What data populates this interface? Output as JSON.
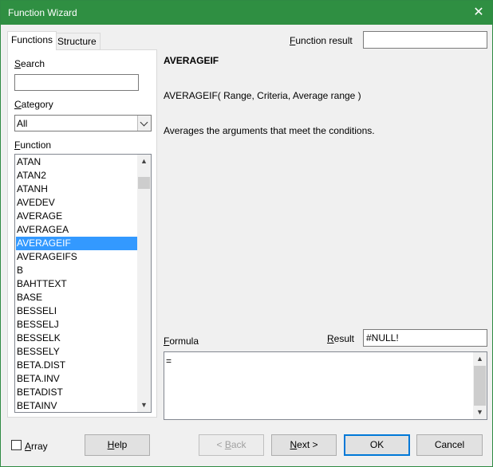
{
  "window": {
    "title": "Function Wizard"
  },
  "tabs": [
    {
      "label": "Functions",
      "active": true
    },
    {
      "label": "Structure",
      "active": false
    }
  ],
  "left": {
    "search_label_first": "S",
    "search_label_rest": "earch",
    "search_value": "",
    "category_label_first": "C",
    "category_label_rest": "ategory",
    "category_value": "All",
    "function_label_first": "F",
    "function_label_rest": "unction",
    "functions": [
      "ATAN",
      "ATAN2",
      "ATANH",
      "AVEDEV",
      "AVERAGE",
      "AVERAGEA",
      "AVERAGEIF",
      "AVERAGEIFS",
      "B",
      "BAHTTEXT",
      "BASE",
      "BESSELI",
      "BESSELJ",
      "BESSELK",
      "BESSELY",
      "BETA.DIST",
      "BETA.INV",
      "BETADIST",
      "BETAINV"
    ],
    "selected_function": "AVERAGEIF"
  },
  "right": {
    "function_result_label_first": "F",
    "function_result_label_rest": "unction result",
    "function_result_value": "",
    "func_name": "AVERAGEIF",
    "func_syntax": "AVERAGEIF( Range, Criteria, Average range )",
    "func_description": "Averages the arguments that meet the conditions.",
    "formula_label_first": "F",
    "formula_label_rest": "ormula",
    "result_label_first": "R",
    "result_label_rest": "esult",
    "result_value": "#NULL!",
    "formula_value": "="
  },
  "buttons": {
    "array_first": "A",
    "array_rest": "rray",
    "help_first": "H",
    "help_rest": "elp",
    "back_pre": "< ",
    "back_first": "B",
    "back_rest": "ack",
    "next_first": "N",
    "next_rest": "ext >",
    "ok": "OK",
    "cancel": "Cancel"
  }
}
